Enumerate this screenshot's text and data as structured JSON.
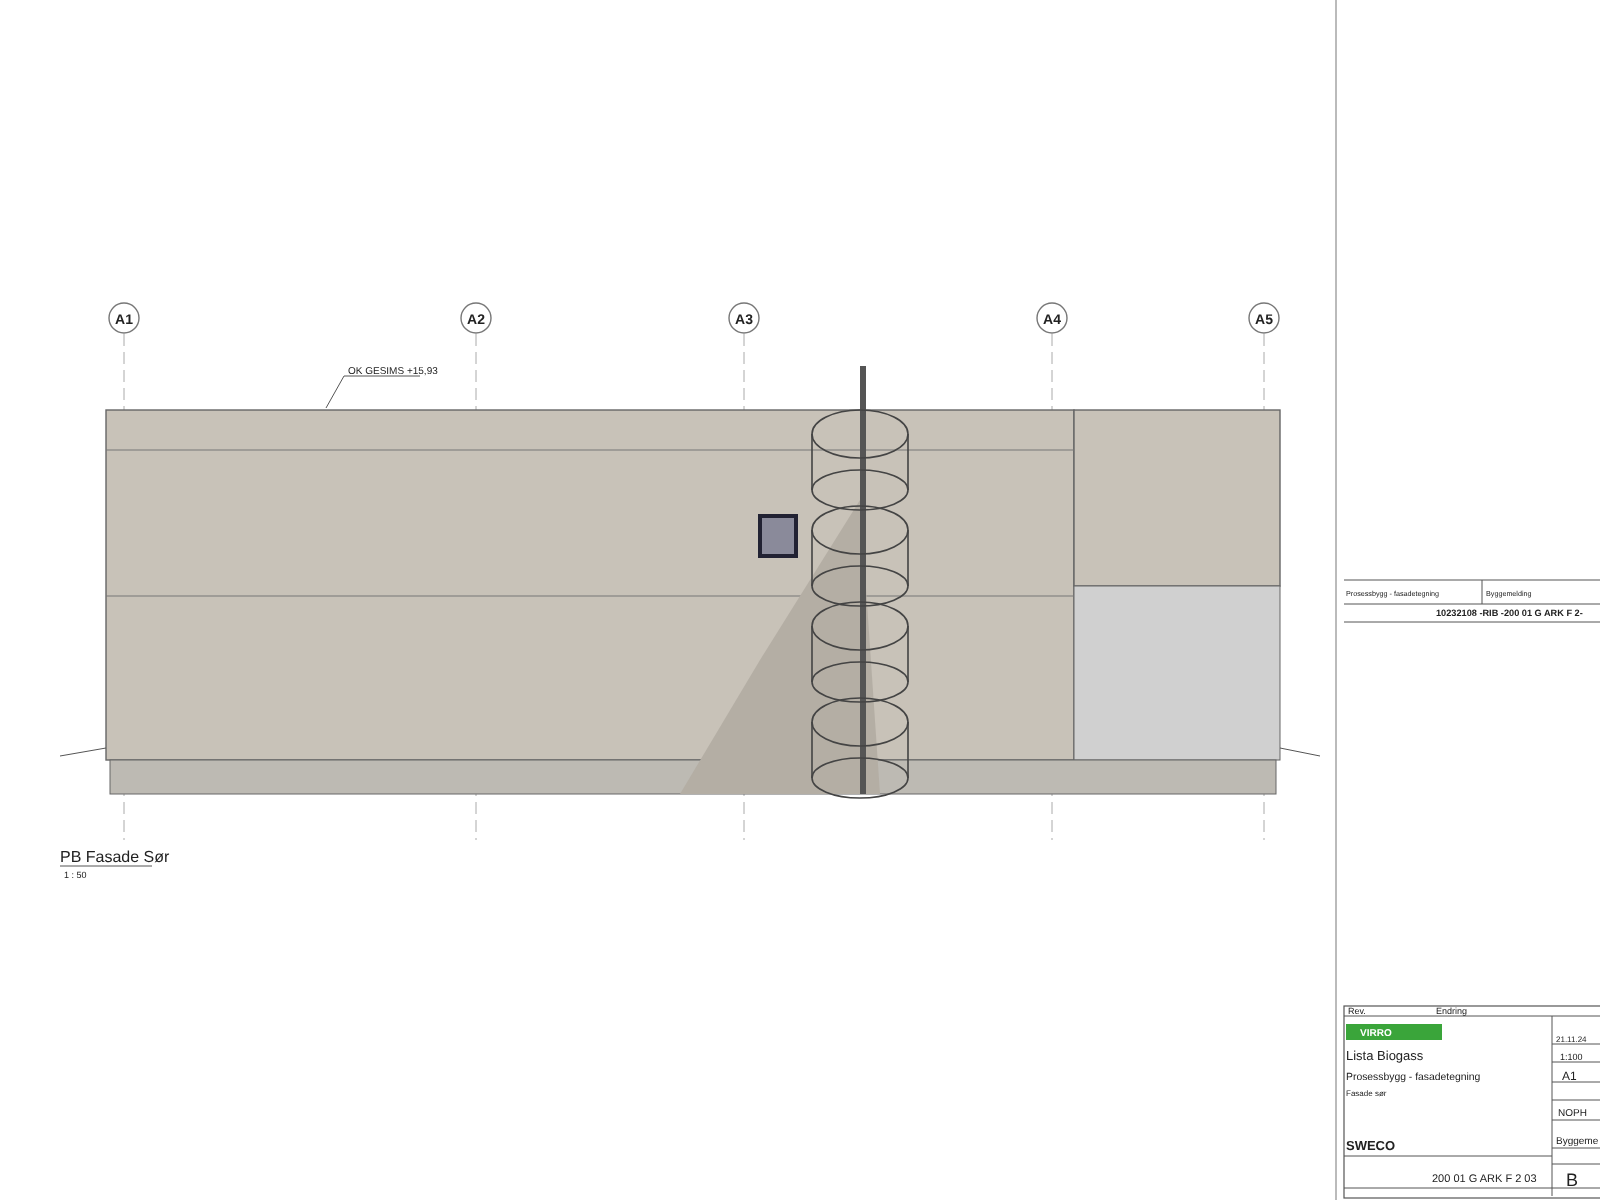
{
  "elevation": {
    "grid_labels": [
      "A1",
      "A2",
      "A3",
      "A4",
      "A5"
    ],
    "level_label": "OK GESIMS +15,93",
    "view_title": "PB Fasade Sør",
    "view_scale": "1 : 50"
  },
  "drawing_list_block": {
    "column_1_value": "Prosessbygg - fasadetegning",
    "column_2_value": "Byggemelding",
    "document_number": "10232108 -RIB -200 01 G ARK F 2-"
  },
  "title_block": {
    "revision_header": "Rev.",
    "change_header": "Endring",
    "client_logo": "VIRRO",
    "project": "Lista Biogass",
    "title": "Prosessbygg - fasadetegning",
    "subtitle": "Fasade sør",
    "company": "SWECO",
    "drawing_number": "200 01 G ARK F 2 03",
    "date": "21.11.24",
    "scale": "1:100",
    "format": "A1",
    "column_4": "NOPH",
    "status": "Byggeme",
    "revision": "B"
  }
}
